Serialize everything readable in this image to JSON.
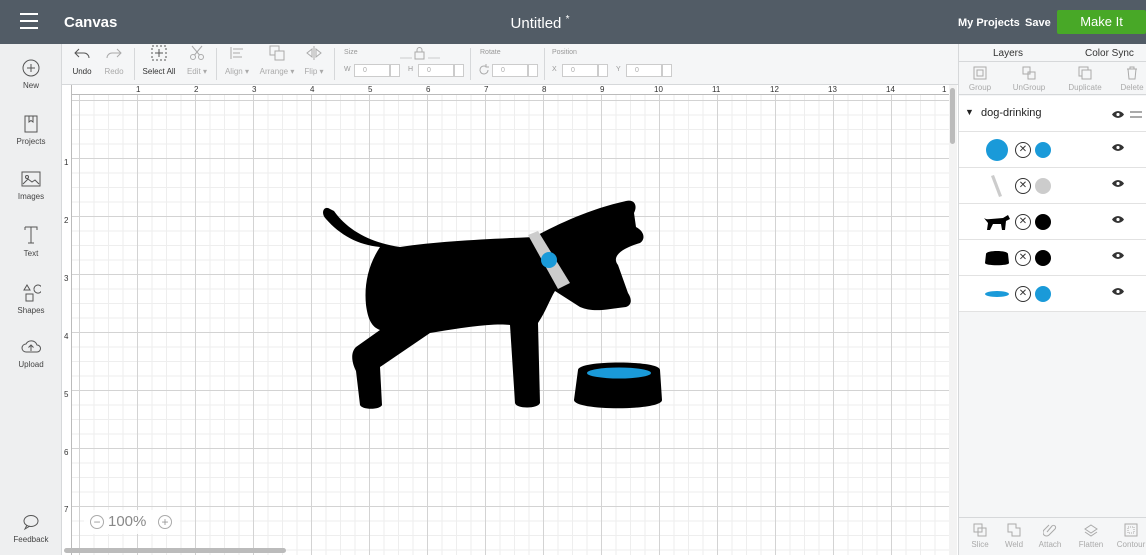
{
  "topbar": {
    "app_title": "Canvas",
    "doc_title": "Untitled",
    "doc_modified_mark": "*",
    "my_projects": "My Projects",
    "save": "Save",
    "make_it": "Make It"
  },
  "leftbar": {
    "new": "New",
    "projects": "Projects",
    "images": "Images",
    "text": "Text",
    "shapes": "Shapes",
    "upload": "Upload",
    "feedback": "Feedback"
  },
  "toolbar": {
    "undo": "Undo",
    "redo": "Redo",
    "select_all": "Select All",
    "edit": "Edit",
    "align": "Align",
    "arrange": "Arrange",
    "flip": "Flip",
    "size": "Size",
    "w_label": "W",
    "w_value": "0",
    "h_label": "H",
    "h_value": "0",
    "rotate": "Rotate",
    "rotate_value": "0",
    "position": "Position",
    "x_label": "X",
    "x_value": "0",
    "y_label": "Y",
    "y_value": "0"
  },
  "ruler": {
    "top": [
      "1",
      "2",
      "3",
      "4",
      "5",
      "6",
      "7",
      "8",
      "9",
      "10",
      "11",
      "12",
      "13",
      "14",
      "1"
    ],
    "left": [
      "1",
      "2",
      "3",
      "4",
      "5",
      "6",
      "7"
    ]
  },
  "zoom": {
    "level": "100%",
    "minus": "−",
    "plus": "+"
  },
  "layers_panel": {
    "tabs": [
      "Layers",
      "Color Sync"
    ],
    "tools": [
      "Group",
      "UnGroup",
      "Duplicate",
      "Delete"
    ],
    "group_name": "dog-drinking",
    "layers": [
      {
        "thumb": "circle",
        "color": "#1a9ad9"
      },
      {
        "thumb": "collar",
        "color": "#cccccc"
      },
      {
        "thumb": "dog",
        "color": "#000000"
      },
      {
        "thumb": "bowl",
        "color": "#000000"
      },
      {
        "thumb": "water",
        "color": "#1a9ad9"
      }
    ],
    "bottom_tools": [
      "Slice",
      "Weld",
      "Attach",
      "Flatten",
      "Contour"
    ]
  },
  "colors": {
    "accent_green": "#48a827",
    "topbar": "#525c66",
    "blue": "#1a9ad9"
  }
}
